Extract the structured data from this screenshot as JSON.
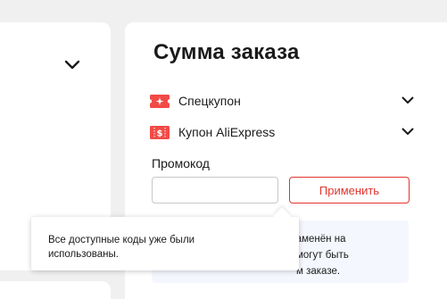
{
  "summary": {
    "title": "Сумма заказа",
    "coupons": [
      {
        "label": "Спецкупон",
        "icon": "coupon-star-icon"
      },
      {
        "label": "Купон AliExpress",
        "icon": "coupon-dollar-icon"
      }
    ],
    "promo": {
      "label": "Промокод",
      "value": "",
      "placeholder": "",
      "apply_label": "Применить"
    },
    "info": {
      "lines": [
        "т заменён на",
        "могут быть",
        "м заказе."
      ]
    }
  },
  "tooltip": {
    "text": "Все доступные коды уже были использованы."
  },
  "left_panel": {
    "chevron_icon": "chevron-down-icon"
  },
  "colors": {
    "accent": "#e2352f",
    "coupon_icon": "#f24a46",
    "page_bg": "#f0f0f0",
    "info_bg": "#f4f7fd"
  }
}
